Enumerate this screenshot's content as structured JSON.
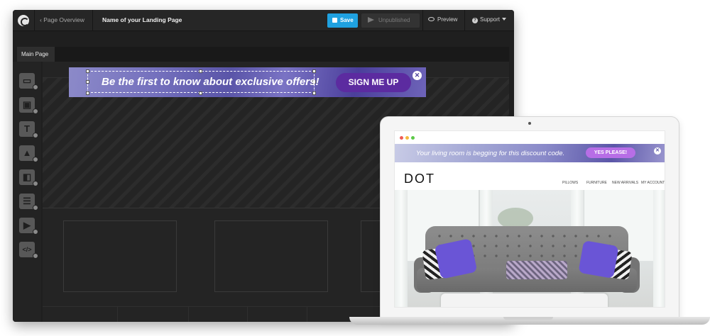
{
  "editor": {
    "back_link": "‹ Page Overview",
    "page_name": "Name of your Landing Page",
    "save_label": "Save",
    "unpublished_label": "Unpublished",
    "preview_label": "Preview",
    "support_label": "Support",
    "tab_main": "Main Page",
    "accent_color": "#1fa1e0",
    "tools": [
      "section-icon",
      "box-icon",
      "text-icon",
      "image-icon",
      "button-icon",
      "form-icon",
      "video-icon",
      "code-icon"
    ],
    "tool_glyphs": [
      "▭",
      "▣",
      "T",
      "▲",
      "◧",
      "☰",
      "▶",
      "</>"
    ]
  },
  "banner": {
    "headline": "Be the first to know about exclusive offers!",
    "cta": "SIGN ME UP",
    "close": "✕",
    "cta_color": "#5c2ba0"
  },
  "site": {
    "banner_text": "Your living room is begging for this discount code.",
    "cta": "YES PLEASE!",
    "close": "✕",
    "logo": "DOT",
    "nav": [
      "PILLOWS",
      "FURNITURE",
      "NEW ARRIVALS",
      "MY ACCOUNT"
    ]
  }
}
